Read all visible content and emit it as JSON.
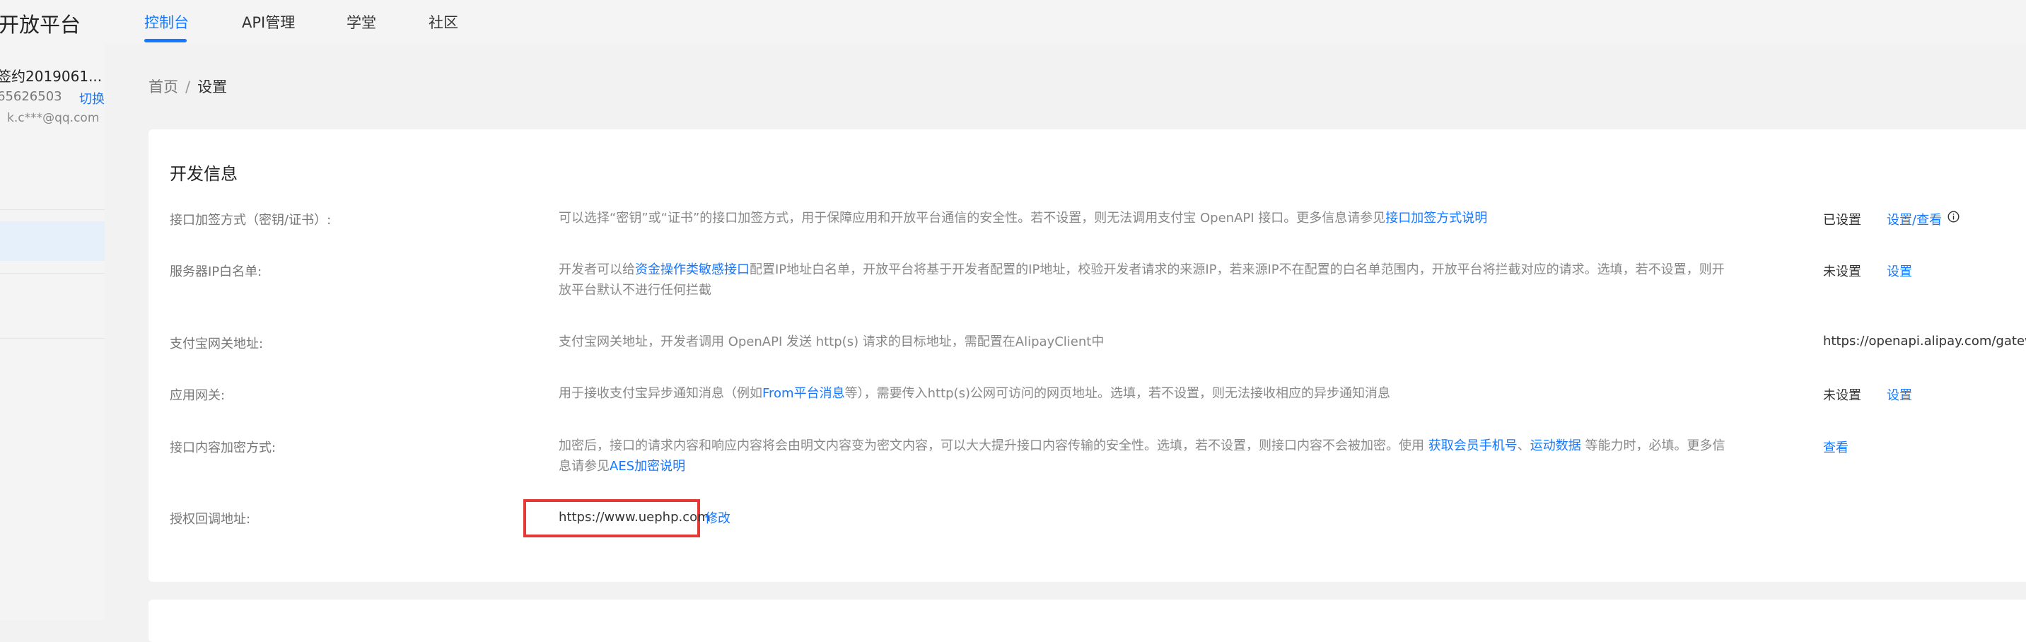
{
  "header": {
    "brand": "开放平台",
    "nav": [
      {
        "label": "控制台",
        "active": true
      },
      {
        "label": "API管理",
        "active": false
      },
      {
        "label": "学堂",
        "active": false
      },
      {
        "label": "社区",
        "active": false
      }
    ]
  },
  "account": {
    "name": "签约2019061...",
    "id": "65626503",
    "switch_label": "切换",
    "email": "k.c***@qq.com"
  },
  "breadcrumb": {
    "home": "首页",
    "separator": "/",
    "current": "设置"
  },
  "section": {
    "title": "开发信息",
    "rows": {
      "signing": {
        "label": "接口加签方式（密钥/证书）:",
        "desc_text": "可以选择“密钥”或“证书”的接口加签方式，用于保障应用和开放平台通信的安全性。若不设置，则无法调用支付宝 OpenAPI 接口。更多信息请参见",
        "desc_link": "接口加签方式说明",
        "status": "已设置",
        "action": "设置/查看"
      },
      "ip_whitelist": {
        "label": "服务器IP白名单:",
        "desc_pre": "开发者可以给",
        "desc_link": "资金操作类敏感接口",
        "desc_post": "配置IP地址白名单，开放平台将基于开发者配置的IP地址，校验开发者请求的来源IP，若来源IP不在配置的白名单范围内，开放平台将拦截对应的请求。选填，若不设置，则开放平台默认不进行任何拦截",
        "status": "未设置",
        "action": "设置"
      },
      "gateway": {
        "label": "支付宝网关地址:",
        "desc": "支付宝网关地址，开发者调用 OpenAPI 发送 http(s) 请求的目标地址，需配置在AlipayClient中",
        "value": "https://openapi.alipay.com/gateway.do"
      },
      "app_gateway": {
        "label": "应用网关:",
        "desc_pre": "用于接收支付宝异步通知消息（例如",
        "desc_link": "From平台消息",
        "desc_post": "等），需要传入http(s)公网可访问的网页地址。选填，若不设置，则无法接收相应的异步通知消息",
        "status": "未设置",
        "action": "设置"
      },
      "encryption": {
        "label": "接口内容加密方式:",
        "desc_pre": "加密后，接口的请求内容和响应内容将会由明文内容变为密文内容，可以大大提升接口内容传输的安全性。选填，若不设置，则接口内容不会被加密。使用 ",
        "desc_link1": "获取会员手机号",
        "desc_sep": "、",
        "desc_link2": "运动数据",
        "desc_mid": " 等能力时，必填。更多信息请参见",
        "desc_link3": "AES加密说明",
        "action": "查看"
      },
      "callback": {
        "label": "授权回调地址:",
        "value": "https://www.uephp.com",
        "action": "修改"
      }
    }
  },
  "colors": {
    "accent": "#1677ff",
    "highlight_box": "#e53935"
  }
}
